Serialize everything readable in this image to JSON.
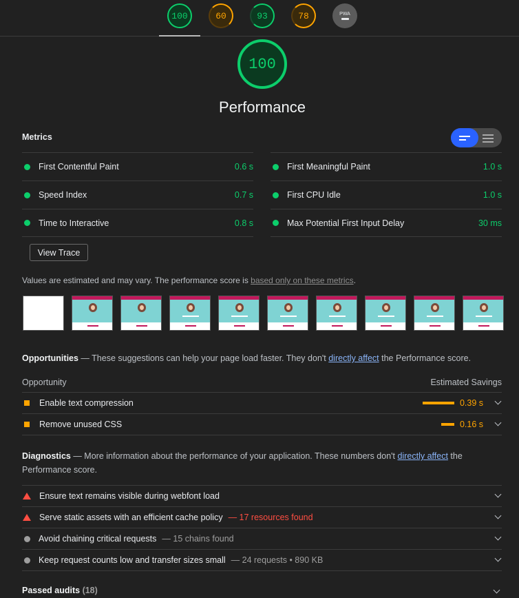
{
  "tabs": [
    {
      "score": "100",
      "color": "green"
    },
    {
      "score": "60",
      "color": "orange"
    },
    {
      "score": "93",
      "color": "green"
    },
    {
      "score": "78",
      "color": "orange"
    },
    {
      "label": "PWA",
      "color": "gray"
    }
  ],
  "gauge": {
    "score": "100",
    "title": "Performance"
  },
  "metrics": {
    "label": "Metrics",
    "left": [
      {
        "name": "First Contentful Paint",
        "value": "0.6 s"
      },
      {
        "name": "Speed Index",
        "value": "0.7 s"
      },
      {
        "name": "Time to Interactive",
        "value": "0.8 s"
      }
    ],
    "right": [
      {
        "name": "First Meaningful Paint",
        "value": "1.0 s"
      },
      {
        "name": "First CPU Idle",
        "value": "1.0 s"
      },
      {
        "name": "Max Potential First Input Delay",
        "value": "30 ms"
      }
    ]
  },
  "view_trace_label": "View Trace",
  "estimate_note": {
    "text": "Values are estimated and may vary. The performance score is ",
    "link": "based only on these metrics",
    "end": "."
  },
  "opportunities": {
    "title": "Opportunities",
    "desc_pre": " — These suggestions can help your page load faster. They don't ",
    "link": "directly affect",
    "desc_post": " the Performance score.",
    "col_left": "Opportunity",
    "col_right": "Estimated Savings",
    "items": [
      {
        "name": "Enable text compression",
        "saving": "0.39 s",
        "fraction": 1.0
      },
      {
        "name": "Remove unused CSS",
        "saving": "0.16 s",
        "fraction": 0.41
      }
    ]
  },
  "diagnostics": {
    "title": "Diagnostics",
    "desc_pre": " — More information about the performance of your application. These numbers don't ",
    "link": "directly affect",
    "desc_post": " the Performance score.",
    "items": [
      {
        "name": "Ensure text remains visible during webfont load",
        "extra": "",
        "severity": "fail"
      },
      {
        "name": "Serve static assets with an efficient cache policy",
        "extra": "— 17 resources found",
        "severity": "fail"
      },
      {
        "name": "Avoid chaining critical requests",
        "extra": "— 15 chains found",
        "severity": "info"
      },
      {
        "name": "Keep request counts low and transfer sizes small",
        "extra": "— 24 requests • 890 KB",
        "severity": "info"
      }
    ]
  },
  "passed": {
    "label": "Passed audits",
    "count": "(18)"
  },
  "colors": {
    "pass": "#0cce6b",
    "average": "#ffa400",
    "fail": "#ff4e42",
    "accent": "#2a62ff"
  }
}
